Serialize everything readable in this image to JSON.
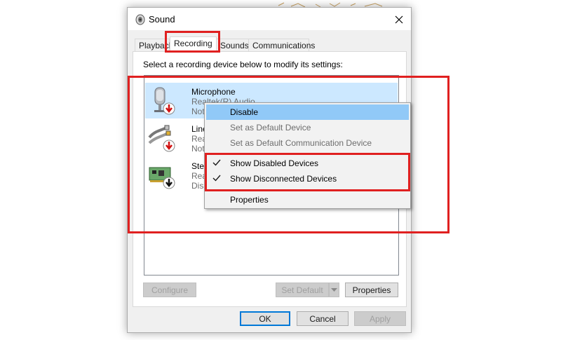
{
  "window": {
    "title": "Sound",
    "close_glyph": "✕"
  },
  "tabs": [
    {
      "label": "Playback"
    },
    {
      "label": "Recording",
      "active": true
    },
    {
      "label": "Sounds"
    },
    {
      "label": "Communications"
    }
  ],
  "instruction": "Select a recording device below to modify its settings:",
  "devices": [
    {
      "name": "Microphone",
      "line2": "Realtek(R) Audio",
      "line3": "Not",
      "icon": "microphone-icon",
      "badge": "red-down-arrow",
      "selected": true
    },
    {
      "name": "Line",
      "line2": "Real",
      "line3": "Not",
      "icon": "line-in-cable-icon",
      "badge": "red-down-arrow"
    },
    {
      "name": "Ster",
      "line2": "Real",
      "line3": "Disa",
      "icon": "sound-card-icon",
      "badge": "black-down-arrow"
    }
  ],
  "context_menu": {
    "items": [
      {
        "label": "Disable",
        "highlighted": true
      },
      {
        "label": "Set as Default Device",
        "disabled": true
      },
      {
        "label": "Set as Default Communication Device",
        "disabled": true
      },
      {
        "label": "Show Disabled Devices",
        "checked": true
      },
      {
        "label": "Show Disconnected Devices",
        "checked": true
      },
      {
        "label": "Properties"
      }
    ]
  },
  "buttons": {
    "configure": "Configure",
    "set_default": "Set Default",
    "properties": "Properties",
    "ok": "OK",
    "cancel": "Cancel",
    "apply": "Apply"
  },
  "colors": {
    "selection": "#cce8ff",
    "menu_highlight": "#91c9f7",
    "annotation": "#e02020",
    "accent": "#0078d7"
  }
}
